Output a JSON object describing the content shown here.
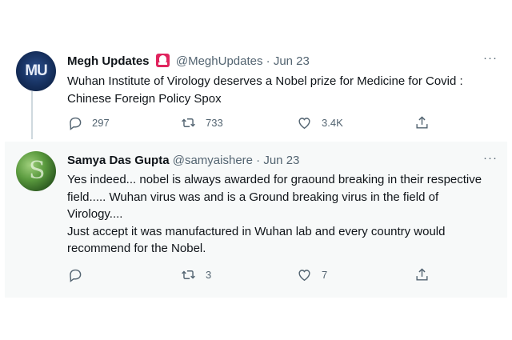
{
  "tweets": [
    {
      "avatar_text": "MU",
      "name": "Megh Updates",
      "handle": "@MeghUpdates",
      "separator": "·",
      "date": "Jun 23",
      "text": "Wuhan Institute of Virology deserves a Nobel prize for Medicine for Covid : Chinese Foreign Policy Spox",
      "replies": "297",
      "retweets": "733",
      "likes": "3.4K",
      "more": "···"
    },
    {
      "name": "Samya Das Gupta",
      "handle": "@samyaishere",
      "separator": "·",
      "date": "Jun 23",
      "text_lines": [
        "Yes indeed... nobel is always awarded for graound breaking in their respective field..... Wuhan virus was and is a Ground breaking virus in the field of Virology....",
        "Just accept it was manufactured in Wuhan lab and every country would recommend for the Nobel."
      ],
      "replies": "",
      "retweets": "3",
      "likes": "7",
      "more": "···"
    }
  ],
  "icons": {
    "badge": "red-siren-emoji-icon",
    "reply": "reply-icon",
    "retweet": "retweet-icon",
    "like": "heart-icon",
    "share": "share-icon"
  },
  "colors": {
    "text": "#0f1419",
    "secondary": "#536471",
    "badge": "#e0245e",
    "reply_bg": "#f7f9f9",
    "thread_line": "#cfd9de"
  }
}
